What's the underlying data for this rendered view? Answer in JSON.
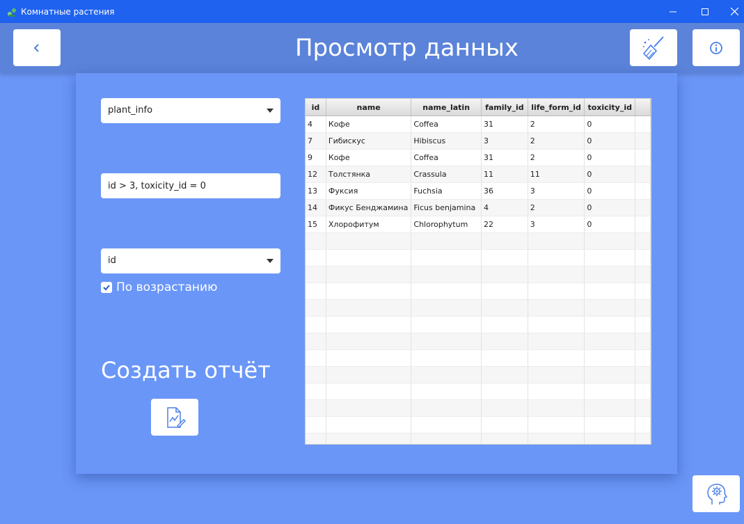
{
  "window": {
    "title": "Комнатные растения",
    "icon": "plant-icon"
  },
  "header": {
    "title": "Просмотр данных",
    "back_icon": "chevron-left-icon",
    "clean_icon": "broom-icon",
    "info_icon": "info-icon"
  },
  "controls": {
    "table_select": "plant_info",
    "filter_value": "id > 3, toxicity_id = 0",
    "sort_select": "id",
    "ascending_label": "По возрастанию",
    "ascending_checked": true,
    "report_title": "Создать отчёт",
    "report_icon": "chart-document-icon"
  },
  "table": {
    "columns": [
      "id",
      "name",
      "name_latin",
      "family_id",
      "life_form_id",
      "toxicity_id"
    ],
    "rows": [
      [
        "4",
        "Кофе",
        "Coffea",
        "31",
        "2",
        "0"
      ],
      [
        "7",
        "Гибискус",
        "Hibiscus",
        "3",
        "2",
        "0"
      ],
      [
        "9",
        "Кофе",
        "Coffea",
        "31",
        "2",
        "0"
      ],
      [
        "12",
        "Толстянка",
        "Crassula",
        "11",
        "11",
        "0"
      ],
      [
        "13",
        "Фуксия",
        "Fuchsia",
        "36",
        "3",
        "0"
      ],
      [
        "14",
        "Фикус Бенджамина",
        "Ficus benjamina",
        "4",
        "2",
        "0"
      ],
      [
        "15",
        "Хлорофитум",
        "Chlorophytum",
        "22",
        "3",
        "0"
      ]
    ],
    "empty_rows": 13
  },
  "footer": {
    "settings_icon": "head-gear-icon"
  },
  "colors": {
    "titlebar": "#1f62ef",
    "header": "#5b83d9",
    "background": "#6a96f8",
    "icon_accent": "#4a7fe8"
  }
}
